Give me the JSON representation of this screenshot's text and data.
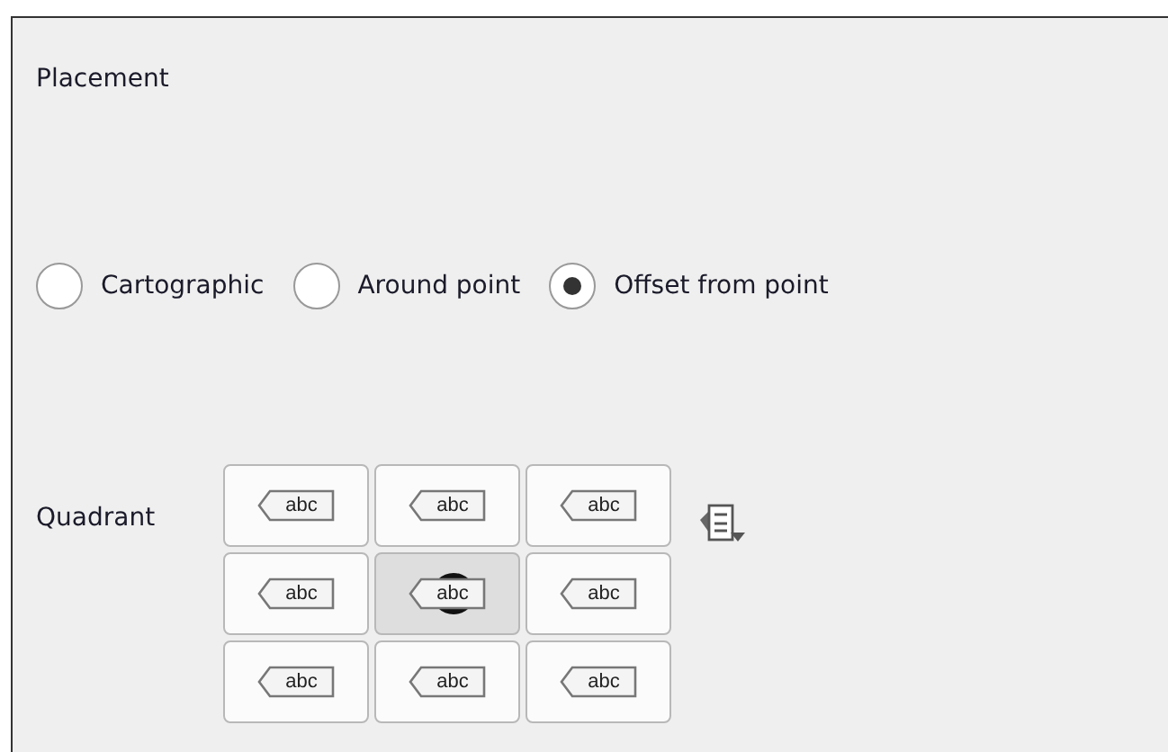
{
  "section": {
    "title": "Placement"
  },
  "placement_modes": [
    {
      "label": "Cartographic",
      "selected": false
    },
    {
      "label": "Around point",
      "selected": false
    },
    {
      "label": "Offset from point",
      "selected": true
    }
  ],
  "quadrant": {
    "label": "Quadrant",
    "cells": [
      {
        "label": "abc",
        "selected": false
      },
      {
        "label": "abc",
        "selected": false
      },
      {
        "label": "abc",
        "selected": false
      },
      {
        "label": "abc",
        "selected": false
      },
      {
        "label": "abc",
        "selected": true
      },
      {
        "label": "abc",
        "selected": false
      },
      {
        "label": "abc",
        "selected": false
      },
      {
        "label": "abc",
        "selected": false
      },
      {
        "label": "abc",
        "selected": false
      }
    ]
  }
}
